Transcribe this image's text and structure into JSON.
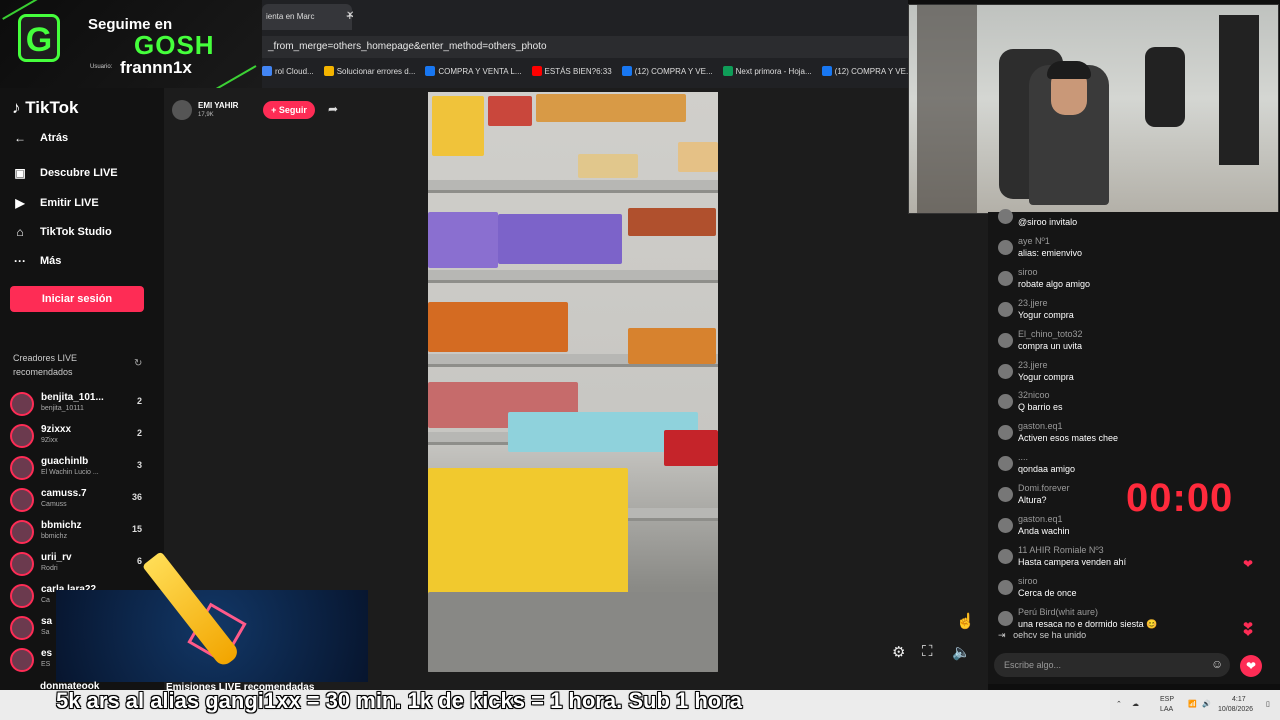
{
  "overlay": {
    "follow_text": "Seguime en",
    "brand": "GOSH",
    "user_label": "Usuario:",
    "username": "frannn1x",
    "logo_letter": "G",
    "accent": "#45ff3c"
  },
  "browser": {
    "tab_title": "ienta en Marc",
    "new_tab": "+",
    "close_tab": "✕",
    "url": "_from_merge=others_homepage&enter_method=others_photo",
    "bookmarks": [
      {
        "label": "rol Cloud...",
        "color": "#4285f4"
      },
      {
        "label": "Solucionar errores d...",
        "color": "#f4b400"
      },
      {
        "label": "COMPRA Y VENTA L...",
        "color": "#1877f2"
      },
      {
        "label": "ESTÁS BIEN?6:33",
        "color": "#ff0000"
      },
      {
        "label": "(12) COMPRA Y VE...",
        "color": "#1877f2"
      },
      {
        "label": "Next primora - Hoja...",
        "color": "#0f9d58"
      },
      {
        "label": "(12) COMPRA Y VE...",
        "color": "#1877f2"
      }
    ]
  },
  "sidebar": {
    "logo": "TikTok",
    "nav": [
      {
        "icon": "←",
        "label": "Atrás"
      },
      {
        "icon": "▣",
        "label": "Descubre LIVE"
      },
      {
        "icon": "▶",
        "label": "Emitir LIVE"
      },
      {
        "icon": "⌂",
        "label": "TikTok Studio"
      },
      {
        "icon": "···",
        "label": "Más"
      }
    ],
    "login": "Iniciar sesión",
    "recommended_title": "Creadores LIVE recomendados",
    "creators": [
      {
        "name": "benjita_101...",
        "sub": "benjita_10111",
        "count": "2"
      },
      {
        "name": "9zixxx",
        "sub": "9Zixx",
        "count": "2"
      },
      {
        "name": "guachinlb",
        "sub": "El Wachin Lucio ...",
        "count": "3"
      },
      {
        "name": "camuss.7",
        "sub": "Camuss",
        "count": "36"
      },
      {
        "name": "bbmichz",
        "sub": "bbmichz",
        "count": "15"
      },
      {
        "name": "urii_rv",
        "sub": "Rodri",
        "count": "6"
      },
      {
        "name": "carla.lara22",
        "sub": "Ca",
        "count": ""
      },
      {
        "name": "sa",
        "sub": "Sa",
        "count": ""
      },
      {
        "name": "es",
        "sub": "ES",
        "count": ""
      }
    ],
    "bottom_user": "donmateook",
    "bottom_section": "Emisiones LIVE recomendadas"
  },
  "stream": {
    "streamer": "EMI YAHIR",
    "viewers": "17,9K",
    "follow": "+ Seguir"
  },
  "chat": {
    "messages": [
      {
        "user": "",
        "text": "@siroo invitalo",
        "heart": false
      },
      {
        "user": "aye  Nº1",
        "text": "alias: emienvivo",
        "heart": false
      },
      {
        "user": "siroo",
        "text": "robate algo amigo",
        "heart": false
      },
      {
        "user": "23.jjere",
        "text": "Yogur compra",
        "heart": false
      },
      {
        "user": "El_chino_toto32",
        "text": "compra un uvita",
        "heart": false
      },
      {
        "user": "23.jjere",
        "text": "Yogur compra",
        "heart": false
      },
      {
        "user": "32nicoo",
        "text": "Q barrio es",
        "heart": false
      },
      {
        "user": "gaston.eq1",
        "text": "Activen esos mates chee",
        "heart": false
      },
      {
        "user": "....",
        "text": "qondaa amigo",
        "heart": false
      },
      {
        "user": "Domi.forever",
        "text": "Altura?",
        "heart": false
      },
      {
        "user": "gaston.eq1",
        "text": "Anda wachin",
        "heart": false
      },
      {
        "user": "11  AHIR  Romiale  Nº3",
        "text": "Hasta campera venden ahí",
        "heart": true
      },
      {
        "user": "siroo",
        "text": "Cerca de once",
        "heart": false
      },
      {
        "user": "Perú Bird(whit aure)",
        "text": "una resaca no e dormido siesta 😊",
        "heart": true
      }
    ],
    "join_user": "oehcv",
    "join_text": "se ha unido",
    "input_placeholder": "Escribe algo...",
    "timer": "00:00"
  },
  "ticker": "5k ars al alias gangi1xx = 30 min. 1k de kicks = 1 hora. Sub 1 hora",
  "taskbar": {
    "lang": "ESP",
    "lang2": "LAA",
    "time": "4:17",
    "date": "10/08/2026"
  }
}
